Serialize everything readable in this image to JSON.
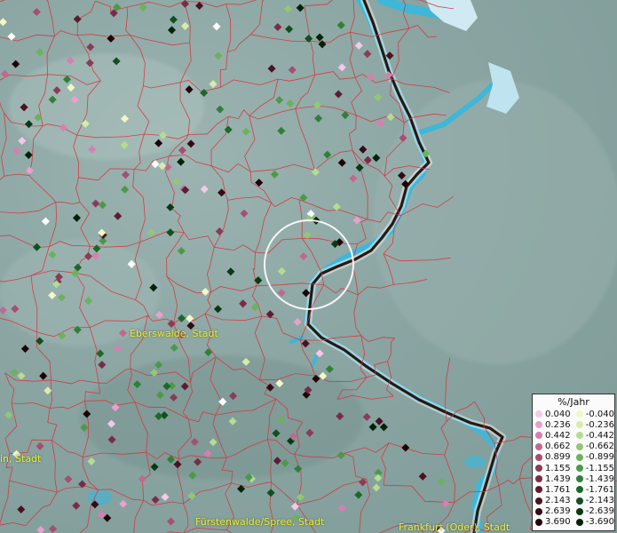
{
  "map": {
    "city_labels": [
      {
        "id": "eberswalde",
        "text": "Eberswalde, Stadt"
      },
      {
        "id": "left",
        "text": "in, Stadt"
      },
      {
        "id": "fuerstenwalde",
        "text": "Fürstenwalde/Spree, Stadt"
      },
      {
        "id": "frankfurt",
        "text": "Frankfurt (Oder), Stadt"
      }
    ],
    "colors": {
      "background": "#8fa9a6",
      "boundary": "#d8323a",
      "river": "#37b6d6",
      "border_line": "#2a1810",
      "highlight_circle": "#ffffff"
    }
  },
  "legend": {
    "title": "%/Jahr",
    "positive": [
      {
        "label": "0.040",
        "color": "#f5c8ea"
      },
      {
        "label": "0.236",
        "color": "#ea9fcf"
      },
      {
        "label": "0.442",
        "color": "#d77fb0"
      },
      {
        "label": "0.662",
        "color": "#c06990"
      },
      {
        "label": "0.899",
        "color": "#a64e73"
      },
      {
        "label": "1.155",
        "color": "#8c3a5a"
      },
      {
        "label": "1.439",
        "color": "#7a2b47"
      },
      {
        "label": "1.761",
        "color": "#5f1b33"
      },
      {
        "label": "2.143",
        "color": "#4a1222"
      },
      {
        "label": "2.639",
        "color": "#350a16"
      },
      {
        "label": "3.690",
        "color": "#1e0409"
      }
    ],
    "negative": [
      {
        "label": "-0.040",
        "color": "#f3f7c6"
      },
      {
        "label": "-0.236",
        "color": "#d8ecaa"
      },
      {
        "label": "-0.442",
        "color": "#b5dc90"
      },
      {
        "label": "-0.662",
        "color": "#90c875"
      },
      {
        "label": "-0.899",
        "color": "#6bb25c"
      },
      {
        "label": "-1.155",
        "color": "#4a9a48"
      },
      {
        "label": "-1.439",
        "color": "#2f8038"
      },
      {
        "label": "-1.761",
        "color": "#1c682a"
      },
      {
        "label": "-2.143",
        "color": "#10501e"
      },
      {
        "label": "-2.639",
        "color": "#073a13"
      },
      {
        "label": "-3.690",
        "color": "#022309"
      }
    ]
  }
}
